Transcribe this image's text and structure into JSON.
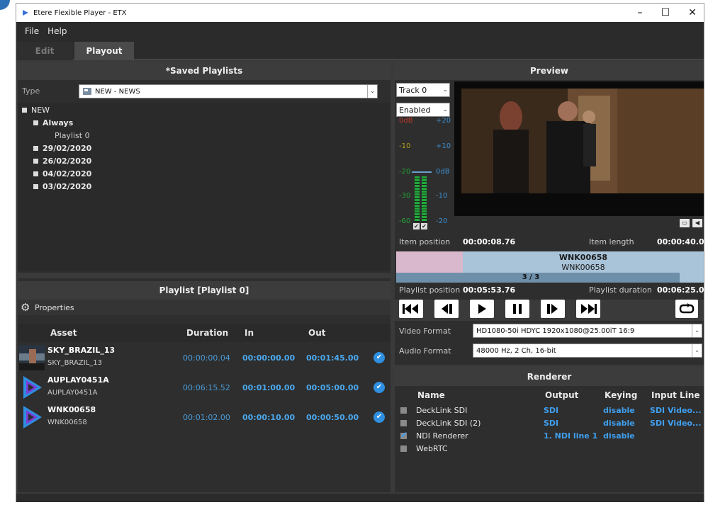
{
  "window": {
    "title": "Etere Flexible Player - ETX",
    "minimize": "–",
    "maximize": "☐",
    "close": "✕"
  },
  "menu": {
    "file": "File",
    "help": "Help"
  },
  "tabs": {
    "edit": "Edit",
    "playout": "Playout"
  },
  "saved_playlists": {
    "title": "*Saved Playlists",
    "type_label": "Type",
    "type_value": "NEW - NEWS",
    "tree": {
      "root": "NEW",
      "always": "Always",
      "playlist0": "Playlist 0",
      "d1": "29/02/2020",
      "d2": "26/02/2020",
      "d3": "04/02/2020",
      "d4": "03/02/2020"
    }
  },
  "playlist": {
    "title": "Playlist  [Playlist 0]",
    "properties": "Properties",
    "columns": {
      "asset": "Asset",
      "duration": "Duration",
      "in": "In",
      "out": "Out"
    },
    "rows": [
      {
        "name": "SKY_BRAZIL_13",
        "sub": "SKY_BRAZIL_13",
        "duration": "00:00:00.04",
        "in": "00:00:00.00",
        "out": "00:01:45.00"
      },
      {
        "name": "AUPLAY0451A",
        "sub": "AUPLAY0451A",
        "duration": "00:06:15.52",
        "in": "00:01:00.00",
        "out": "00:05:00.00"
      },
      {
        "name": "WNK00658",
        "sub": "WNK00658",
        "duration": "00:01:02.00",
        "in": "00:00:10.00",
        "out": "00:00:50.00"
      }
    ]
  },
  "preview": {
    "title": "Preview",
    "track": "Track 0",
    "enabled": "Enabled",
    "vu_left": [
      "0dB",
      "-10",
      "-20",
      "-30",
      "-60"
    ],
    "vu_right": [
      "+20",
      "+10",
      "0dB",
      "-10",
      "-20"
    ],
    "item_position_label": "Item position",
    "item_position": "00:00:08.76",
    "item_length_label": "Item length",
    "item_length": "00:00:40.00",
    "timeline_title": "WNK00658",
    "timeline_sub": "WNK00658",
    "timeline_count": "3 / 3",
    "playlist_position_label": "Playlist position",
    "playlist_position": "00:05:53.76",
    "playlist_duration_label": "Playlist duration",
    "playlist_duration": "00:06:25.00"
  },
  "formats": {
    "video_label": "Video Format",
    "video_value": "HD1080-50i HDYC 1920x1080@25.00iT 16:9",
    "audio_label": "Audio Format",
    "audio_value": "48000 Hz, 2 Ch, 16-bit"
  },
  "renderer": {
    "title": "Renderer",
    "columns": {
      "name": "Name",
      "output": "Output",
      "keying": "Keying",
      "input": "Input Line"
    },
    "rows": [
      {
        "name": "DeckLink SDI",
        "output": "SDI",
        "keying": "disable",
        "input": "SDI Video..."
      },
      {
        "name": "DeckLink SDI (2)",
        "output": "SDI",
        "keying": "disable",
        "input": "SDI Video..."
      },
      {
        "name": "NDI Renderer",
        "output": "1. NDI line 1",
        "keying": "disable",
        "input": ""
      },
      {
        "name": "WebRTC",
        "output": "",
        "keying": "",
        "input": ""
      }
    ]
  },
  "colors": {
    "accent_blue": "#3f9ff0",
    "panel": "#2e2e2e",
    "header": "#3c3c3c"
  }
}
